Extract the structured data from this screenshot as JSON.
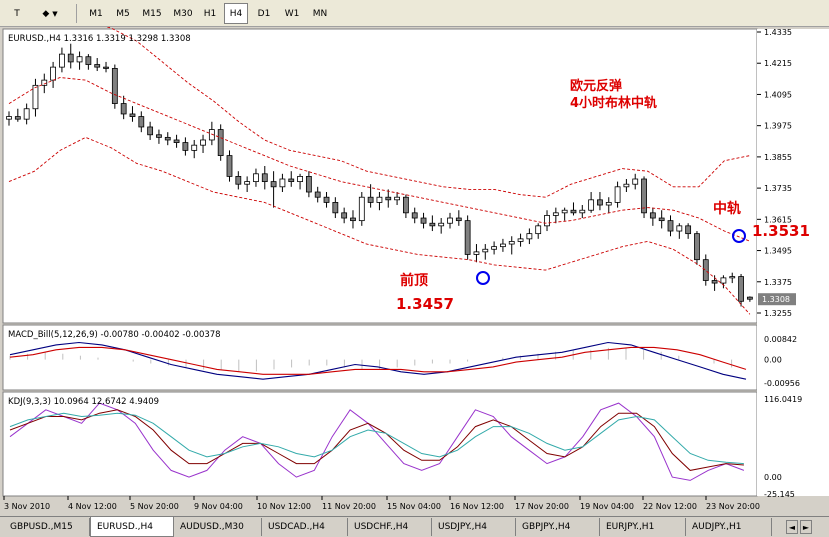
{
  "toolbar": {
    "text_tool_label": "T",
    "shapes_label": "◆",
    "timeframes": [
      "M1",
      "M5",
      "M15",
      "M30",
      "H1",
      "H4",
      "D1",
      "W1",
      "MN"
    ],
    "active_timeframe": "H4"
  },
  "main_panel": {
    "header": "EURUSD.,H4  1.3316 1.3319 1.3298 1.3308",
    "price_ticks": [
      "1.4335",
      "1.4215",
      "1.4095",
      "1.3975",
      "1.3855",
      "1.3735",
      "1.3615",
      "1.3495",
      "1.3375",
      "1.3255"
    ],
    "current_price": "1.3308",
    "annotations": {
      "title_line1": "欧元反弹",
      "title_line2": "4小时布林中轨",
      "previous_top_label": "前顶",
      "previous_top_value": "1.3457",
      "middle_band_label": "中轨",
      "middle_band_value": "1.3531"
    }
  },
  "macd_panel": {
    "header": "MACD_Bill(5,12,26,9) -0.00780 -0.00402 -0.00378",
    "ticks": [
      "0.00842",
      "0.00",
      "-0.00956"
    ]
  },
  "kdj_panel": {
    "header": "KDJ(9,3,3) 10.0964 12.6742 4.9409",
    "ticks": [
      "116.0419",
      "0.00",
      "-25.145"
    ]
  },
  "time_axis": [
    "3 Nov 2010",
    "4 Nov 12:00",
    "5 Nov 20:00",
    "9 Nov 04:00",
    "10 Nov 12:00",
    "11 Nov 20:00",
    "15 Nov 04:00",
    "16 Nov 12:00",
    "17 Nov 20:00",
    "19 Nov 04:00",
    "22 Nov 12:00",
    "23 Nov 20:00"
  ],
  "symbol_tabs": [
    "GBPUSD.,M15",
    "EURUSD.,H4",
    "AUDUSD.,M30",
    "USDCAD.,H4",
    "USDCHF.,H4",
    "USDJPY.,H4",
    "GBPJPY.,H4",
    "EURJPY.,H1",
    "AUDJPY.,H1"
  ],
  "active_tab": "EURUSD.,H4",
  "colors": {
    "bollinger": "#cc0000",
    "annotation_red": "#dd0000",
    "macd_blue": "#000080",
    "macd_red": "#cc0000",
    "k_line": "#9933cc",
    "d_line": "#800000",
    "j_line": "#33aaaa"
  },
  "chart_data": {
    "type": "candlestick",
    "symbol": "EURUSD.",
    "timeframe": "H4",
    "ohlc": [
      [
        1.4,
        1.403,
        1.3975,
        1.401
      ],
      [
        1.401,
        1.404,
        1.399,
        1.4
      ],
      [
        1.4,
        1.406,
        1.398,
        1.404
      ],
      [
        1.404,
        1.4155,
        1.401,
        1.413
      ],
      [
        1.413,
        1.4175,
        1.41,
        1.415
      ],
      [
        1.415,
        1.422,
        1.412,
        1.42
      ],
      [
        1.42,
        1.4275,
        1.418,
        1.425
      ],
      [
        1.425,
        1.429,
        1.4195,
        1.422
      ],
      [
        1.422,
        1.426,
        1.419,
        1.424
      ],
      [
        1.424,
        1.425,
        1.419,
        1.421
      ],
      [
        1.421,
        1.4235,
        1.4185,
        1.42
      ],
      [
        1.42,
        1.422,
        1.418,
        1.4195
      ],
      [
        1.4195,
        1.421,
        1.404,
        1.406
      ],
      [
        1.406,
        1.409,
        1.4,
        1.402
      ],
      [
        1.402,
        1.405,
        1.399,
        1.401
      ],
      [
        1.401,
        1.403,
        1.395,
        1.397
      ],
      [
        1.397,
        1.399,
        1.392,
        1.394
      ],
      [
        1.394,
        1.396,
        1.3905,
        1.393
      ],
      [
        1.393,
        1.395,
        1.39,
        1.392
      ],
      [
        1.392,
        1.394,
        1.389,
        1.391
      ],
      [
        1.391,
        1.393,
        1.386,
        1.388
      ],
      [
        1.388,
        1.392,
        1.385,
        1.39
      ],
      [
        1.39,
        1.394,
        1.387,
        1.392
      ],
      [
        1.392,
        1.399,
        1.39,
        1.396
      ],
      [
        1.396,
        1.398,
        1.384,
        1.386
      ],
      [
        1.386,
        1.388,
        1.376,
        1.378
      ],
      [
        1.378,
        1.38,
        1.373,
        1.375
      ],
      [
        1.375,
        1.378,
        1.372,
        1.376
      ],
      [
        1.376,
        1.381,
        1.374,
        1.379
      ],
      [
        1.379,
        1.382,
        1.373,
        1.376
      ],
      [
        1.376,
        1.38,
        1.366,
        1.374
      ],
      [
        1.374,
        1.379,
        1.372,
        1.377
      ],
      [
        1.377,
        1.38,
        1.374,
        1.376
      ],
      [
        1.376,
        1.379,
        1.373,
        1.378
      ],
      [
        1.378,
        1.38,
        1.37,
        1.372
      ],
      [
        1.372,
        1.374,
        1.368,
        1.37
      ],
      [
        1.37,
        1.372,
        1.366,
        1.368
      ],
      [
        1.368,
        1.37,
        1.362,
        1.364
      ],
      [
        1.364,
        1.366,
        1.36,
        1.362
      ],
      [
        1.362,
        1.365,
        1.358,
        1.361
      ],
      [
        1.361,
        1.372,
        1.359,
        1.37
      ],
      [
        1.37,
        1.375,
        1.366,
        1.368
      ],
      [
        1.368,
        1.372,
        1.365,
        1.37
      ],
      [
        1.37,
        1.373,
        1.366,
        1.369
      ],
      [
        1.369,
        1.372,
        1.367,
        1.37
      ],
      [
        1.37,
        1.371,
        1.362,
        1.364
      ],
      [
        1.364,
        1.366,
        1.36,
        1.362
      ],
      [
        1.362,
        1.364,
        1.358,
        1.36
      ],
      [
        1.36,
        1.363,
        1.357,
        1.359
      ],
      [
        1.359,
        1.362,
        1.356,
        1.36
      ],
      [
        1.36,
        1.364,
        1.358,
        1.362
      ],
      [
        1.362,
        1.365,
        1.359,
        1.361
      ],
      [
        1.361,
        1.363,
        1.346,
        1.348
      ],
      [
        1.348,
        1.352,
        1.345,
        1.349
      ],
      [
        1.349,
        1.352,
        1.346,
        1.35
      ],
      [
        1.35,
        1.353,
        1.348,
        1.351
      ],
      [
        1.351,
        1.354,
        1.349,
        1.352
      ],
      [
        1.352,
        1.355,
        1.348,
        1.353
      ],
      [
        1.353,
        1.356,
        1.351,
        1.354
      ],
      [
        1.354,
        1.358,
        1.352,
        1.356
      ],
      [
        1.356,
        1.36,
        1.354,
        1.359
      ],
      [
        1.359,
        1.365,
        1.357,
        1.363
      ],
      [
        1.363,
        1.366,
        1.36,
        1.364
      ],
      [
        1.364,
        1.366,
        1.361,
        1.365
      ],
      [
        1.365,
        1.368,
        1.363,
        1.364
      ],
      [
        1.364,
        1.367,
        1.362,
        1.365
      ],
      [
        1.365,
        1.372,
        1.364,
        1.369
      ],
      [
        1.369,
        1.372,
        1.365,
        1.367
      ],
      [
        1.367,
        1.37,
        1.364,
        1.368
      ],
      [
        1.368,
        1.376,
        1.366,
        1.374
      ],
      [
        1.374,
        1.377,
        1.372,
        1.375
      ],
      [
        1.375,
        1.379,
        1.373,
        1.377
      ],
      [
        1.377,
        1.378,
        1.362,
        1.364
      ],
      [
        1.364,
        1.366,
        1.359,
        1.362
      ],
      [
        1.362,
        1.365,
        1.358,
        1.361
      ],
      [
        1.361,
        1.363,
        1.355,
        1.357
      ],
      [
        1.357,
        1.36,
        1.354,
        1.359
      ],
      [
        1.359,
        1.36,
        1.354,
        1.356
      ],
      [
        1.356,
        1.357,
        1.344,
        1.346
      ],
      [
        1.346,
        1.348,
        1.336,
        1.338
      ],
      [
        1.338,
        1.34,
        1.334,
        1.337
      ],
      [
        1.337,
        1.34,
        1.335,
        1.339
      ],
      [
        1.339,
        1.341,
        1.337,
        1.3395
      ],
      [
        1.3395,
        1.3405,
        1.328,
        1.33
      ],
      [
        1.3316,
        1.3319,
        1.3298,
        1.3308
      ]
    ],
    "bollinger_upper": [
      1.44,
      1.441,
      1.44,
      1.438,
      1.435,
      1.43,
      1.422,
      1.414,
      1.407,
      1.399,
      1.392,
      1.388,
      1.386,
      1.384,
      1.38,
      1.378,
      1.376,
      1.374,
      1.373,
      1.373,
      1.371,
      1.37,
      1.375,
      1.378,
      1.381,
      1.38,
      1.374,
      1.374,
      1.384,
      1.386
    ],
    "bollinger_middle": [
      1.406,
      1.412,
      1.416,
      1.415,
      1.41,
      1.406,
      1.402,
      1.398,
      1.394,
      1.39,
      1.386,
      1.382,
      1.379,
      1.376,
      1.374,
      1.372,
      1.37,
      1.368,
      1.366,
      1.364,
      1.362,
      1.36,
      1.361,
      1.363,
      1.365,
      1.366,
      1.365,
      1.362,
      1.357,
      1.3531
    ],
    "bollinger_lower": [
      1.376,
      1.38,
      1.388,
      1.393,
      1.389,
      1.383,
      1.38,
      1.376,
      1.372,
      1.37,
      1.368,
      1.364,
      1.36,
      1.356,
      1.352,
      1.35,
      1.348,
      1.347,
      1.346,
      1.344,
      1.343,
      1.342,
      1.345,
      1.348,
      1.351,
      1.353,
      1.35,
      1.344,
      1.336,
      1.325
    ]
  }
}
